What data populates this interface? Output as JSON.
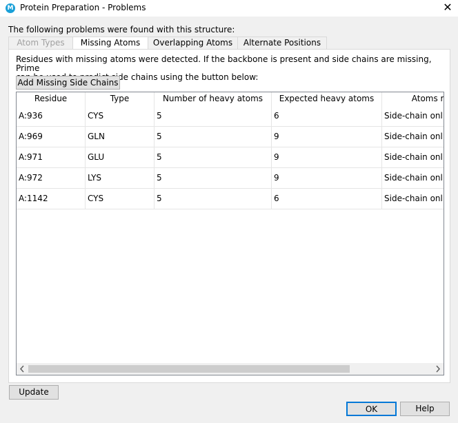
{
  "window": {
    "app_icon_letter": "M",
    "title": "Protein Preparation - Problems",
    "close_glyph": "✕"
  },
  "problems_label": "The following problems were found with this structure:",
  "tabs": [
    {
      "label": "Atom Types",
      "state": "disabled"
    },
    {
      "label": "Missing Atoms",
      "state": "active"
    },
    {
      "label": "Overlapping Atoms",
      "state": "normal"
    },
    {
      "label": "Alternate Positions",
      "state": "normal"
    }
  ],
  "description": {
    "line1": "Residues with missing atoms were detected. If the backbone is present and side chains are missing, Prime",
    "line2": "can be used to predict side chains using the button below:"
  },
  "add_side_chains_label": "Add Missing Side Chains",
  "table": {
    "columns": [
      "Residue",
      "Type",
      "Number of heavy atoms",
      "Expected heavy atoms",
      "Atoms m"
    ],
    "rows": [
      [
        "A:936",
        "CYS",
        "5",
        "6",
        "Side-chain onl"
      ],
      [
        "A:969",
        "GLN",
        "5",
        "9",
        "Side-chain onl"
      ],
      [
        "A:971",
        "GLU",
        "5",
        "9",
        "Side-chain onl"
      ],
      [
        "A:972",
        "LYS",
        "5",
        "9",
        "Side-chain onl"
      ],
      [
        "A:1142",
        "CYS",
        "5",
        "6",
        "Side-chain onl"
      ]
    ]
  },
  "scrollbar": {
    "left_icon": "chevron-left-icon",
    "right_icon": "chevron-right-icon"
  },
  "buttons": {
    "update": "Update",
    "ok": "OK",
    "help": "Help"
  },
  "colors": {
    "accent": "#0078d7",
    "app_icon": "#1aa0d8"
  }
}
